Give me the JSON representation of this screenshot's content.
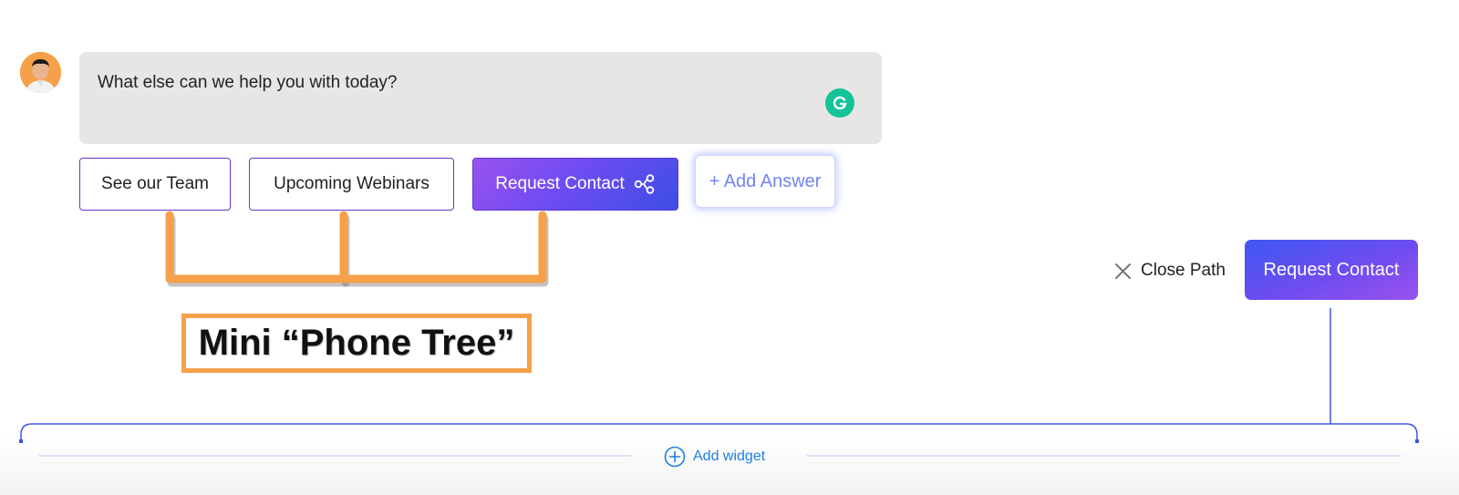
{
  "message": {
    "text": "What else can we help you with today?"
  },
  "answers": [
    {
      "label": "See our Team"
    },
    {
      "label": "Upcoming Webinars"
    },
    {
      "label": "Request Contact"
    }
  ],
  "add_answer_label": "+ Add Answer",
  "path": {
    "close_label": "Close Path",
    "node_label": "Request Contact"
  },
  "annotation": {
    "label": "Mini “Phone Tree”"
  },
  "footer": {
    "add_widget_label": "Add widget"
  },
  "colors": {
    "accent_purple": "#6b34c7",
    "gradient_start": "#9a52ee",
    "gradient_end": "#3d4ee6",
    "annotation_orange": "#f6a04a",
    "link_blue": "#1e7fe0",
    "grammarly_green": "#15c39a"
  }
}
